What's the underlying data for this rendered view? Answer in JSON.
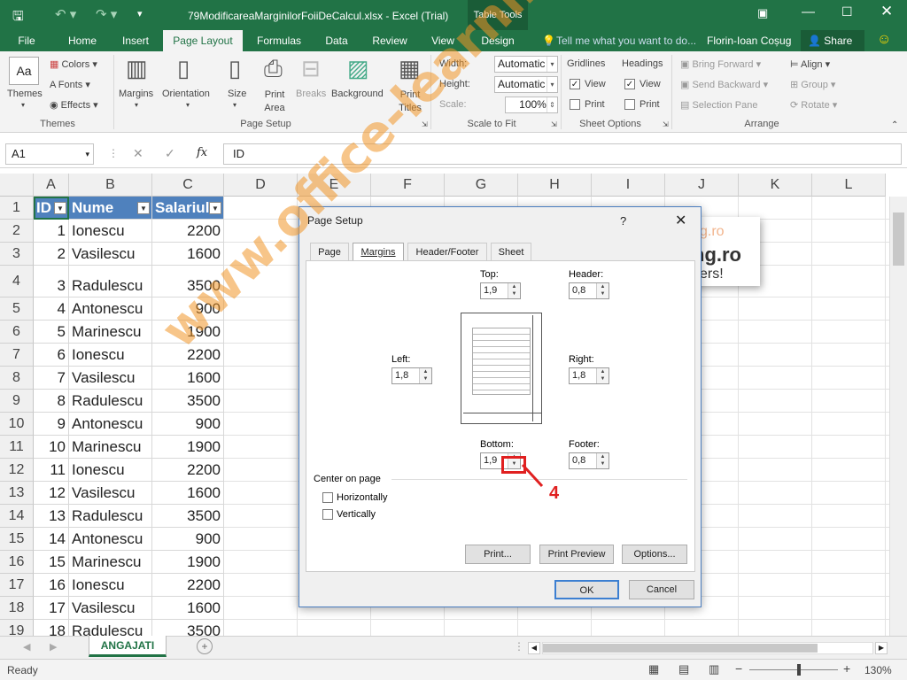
{
  "app": {
    "title": "79ModificareaMarginilorFoiiDeCalcul.xlsx - Excel (Trial)",
    "context_tab": "Table Tools",
    "user": "Florin-Ioan Coșug",
    "share": "Share",
    "tell_me": "Tell me what you want to do..."
  },
  "tabs": [
    "File",
    "Home",
    "Insert",
    "Page Layout",
    "Formulas",
    "Data",
    "Review",
    "View",
    "Design"
  ],
  "ribbon": {
    "themes": {
      "themes": "Themes",
      "colors": "Colors",
      "fonts": "Fonts",
      "effects": "Effects",
      "group": "Themes"
    },
    "page_setup": {
      "margins": "Margins",
      "orientation": "Orientation",
      "size": "Size",
      "print_area": "Print Area",
      "breaks": "Breaks",
      "background": "Background",
      "print_titles": "Print Titles",
      "group": "Page Setup"
    },
    "scale": {
      "width": "Width:",
      "height": "Height:",
      "scale": "Scale:",
      "width_val": "Automatic",
      "height_val": "Automatic",
      "scale_val": "100%",
      "group": "Scale to Fit"
    },
    "sheet_options": {
      "gridlines": "Gridlines",
      "headings": "Headings",
      "view": "View",
      "print": "Print",
      "group": "Sheet Options"
    },
    "arrange": {
      "bring_forward": "Bring Forward",
      "send_backward": "Send Backward",
      "selection_pane": "Selection Pane",
      "align": "Align",
      "group_btn": "Group",
      "rotate": "Rotate",
      "group": "Arrange"
    }
  },
  "formula": {
    "name_box": "A1",
    "fx": "fx",
    "content": "ID"
  },
  "columns": [
    "A",
    "B",
    "C",
    "D",
    "E",
    "F",
    "G",
    "H",
    "I",
    "J",
    "K",
    "L"
  ],
  "headers": [
    "ID",
    "Nume",
    "Salariul"
  ],
  "rows": [
    [
      "1",
      "Ionescu",
      "2200"
    ],
    [
      "2",
      "Vasilescu",
      "1600"
    ],
    [
      "3",
      "Radulescu",
      "3500"
    ],
    [
      "4",
      "Antonescu",
      "900"
    ],
    [
      "5",
      "Marinescu",
      "1900"
    ],
    [
      "6",
      "Ionescu",
      "2200"
    ],
    [
      "7",
      "Vasilescu",
      "1600"
    ],
    [
      "8",
      "Radulescu",
      "3500"
    ],
    [
      "9",
      "Antonescu",
      "900"
    ],
    [
      "10",
      "Marinescu",
      "1900"
    ],
    [
      "11",
      "Ionescu",
      "2200"
    ],
    [
      "12",
      "Vasilescu",
      "1600"
    ],
    [
      "13",
      "Radulescu",
      "3500"
    ],
    [
      "14",
      "Antonescu",
      "900"
    ],
    [
      "15",
      "Marinescu",
      "1900"
    ],
    [
      "16",
      "Ionescu",
      "2200"
    ],
    [
      "17",
      "Vasilescu",
      "1600"
    ],
    [
      "18",
      "Radulescu",
      "3500"
    ]
  ],
  "row_numbers": [
    "1",
    "2",
    "3",
    "4",
    "5",
    "6",
    "7",
    "8",
    "9",
    "10",
    "11",
    "12",
    "13",
    "14",
    "15",
    "16",
    "17",
    "18",
    "19"
  ],
  "sheet_tab": "ANGAJATI",
  "status": {
    "ready": "Ready",
    "zoom": "130%"
  },
  "dialog": {
    "title": "Page Setup",
    "tabs": [
      "Page",
      "Margins",
      "Header/Footer",
      "Sheet"
    ],
    "top_label": "Top:",
    "top": "1,9",
    "header_label": "Header:",
    "header": "0,8",
    "left_label": "Left:",
    "left": "1,8",
    "right_label": "Right:",
    "right": "1,8",
    "bottom_label": "Bottom:",
    "bottom": "1,9",
    "footer_label": "Footer:",
    "footer": "0,8",
    "center_label": "Center on page",
    "horizontally": "Horizontally",
    "vertically": "Vertically",
    "print": "Print...",
    "print_preview": "Print Preview",
    "options": "Options...",
    "ok": "OK",
    "cancel": "Cancel"
  },
  "annotation": "4",
  "bg_logo": {
    "line1": "g.ro",
    "line2": "ng.ro",
    "line3": "ers!"
  },
  "watermark": "www.office-learning.ro",
  "colors": {
    "excel_green": "#217346",
    "table_header": "#4f81bd",
    "annotation_red": "#e02020"
  }
}
